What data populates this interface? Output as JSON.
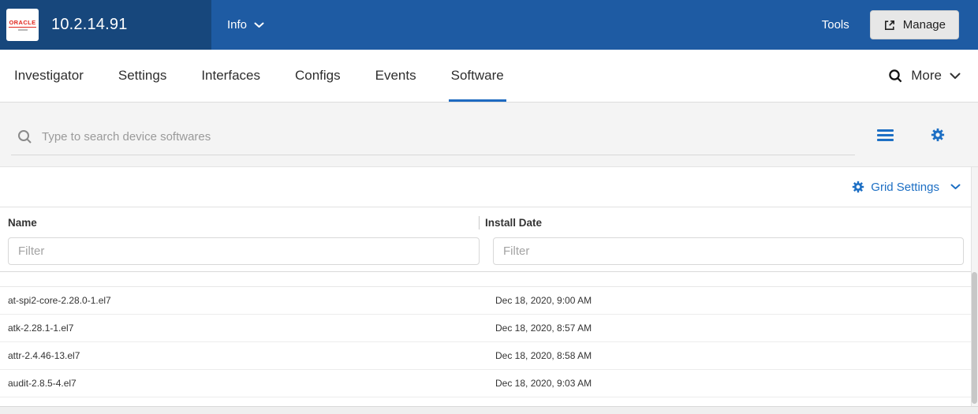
{
  "header": {
    "logo_text": "ORACLE",
    "device_ip": "10.2.14.91",
    "info_label": "Info",
    "tools_label": "Tools",
    "manage_label": "Manage"
  },
  "tabs": {
    "items": [
      {
        "label": "Investigator",
        "active": false
      },
      {
        "label": "Settings",
        "active": false
      },
      {
        "label": "Interfaces",
        "active": false
      },
      {
        "label": "Configs",
        "active": false
      },
      {
        "label": "Events",
        "active": false
      },
      {
        "label": "Software",
        "active": true
      }
    ],
    "more_label": "More"
  },
  "search": {
    "placeholder": "Type to search device softwares",
    "value": ""
  },
  "grid": {
    "settings_label": "Grid Settings",
    "columns": [
      {
        "label": "Name",
        "filter_placeholder": "Filter",
        "filter_value": ""
      },
      {
        "label": "Install Date",
        "filter_placeholder": "Filter",
        "filter_value": ""
      }
    ],
    "rows": [
      {
        "name": "at-spi2-core-2.28.0-1.el7",
        "install_date": "Dec 18, 2020, 9:00 AM"
      },
      {
        "name": "atk-2.28.1-1.el7",
        "install_date": "Dec 18, 2020, 8:57 AM"
      },
      {
        "name": "attr-2.4.46-13.el7",
        "install_date": "Dec 18, 2020, 8:58 AM"
      },
      {
        "name": "audit-2.8.5-4.el7",
        "install_date": "Dec 18, 2020, 9:03 AM"
      }
    ]
  },
  "icons": {
    "header": [
      "external-link-icon",
      "chevron-down-icon"
    ],
    "tabbar": [
      "search-icon",
      "chevron-down-icon"
    ],
    "search_section": [
      "search-icon",
      "hamburger-icon",
      "gear-icon"
    ],
    "grid": [
      "gear-icon",
      "chevron-down-icon"
    ]
  },
  "colors": {
    "header_blue": "#1e5ba3",
    "header_dark_blue": "#17477c",
    "accent_blue": "#1d6fc4",
    "tab_underline": "#1e6ac1",
    "oracle_red": "#e1261d",
    "section_gray": "#f4f4f4",
    "text_dark": "#2e2e2e"
  }
}
